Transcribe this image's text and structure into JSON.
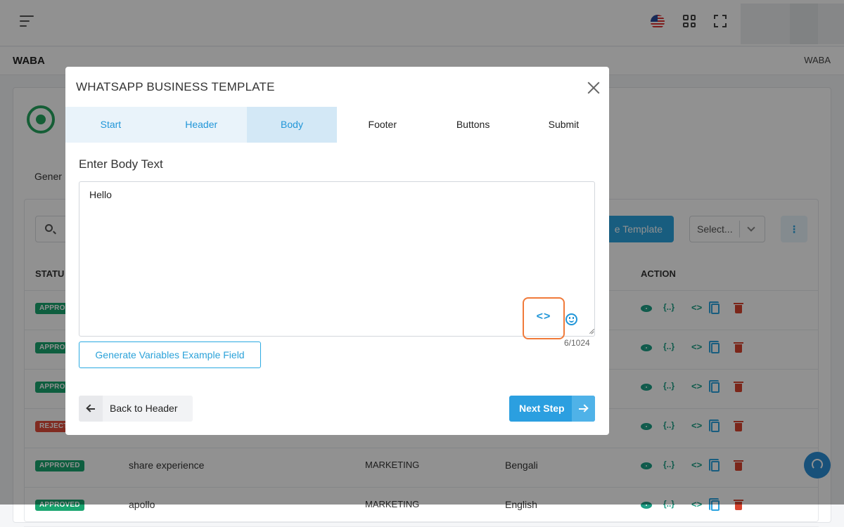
{
  "app": {
    "page_title": "WABA",
    "breadcrumb": "WABA",
    "tab_general": "Gener",
    "create_button": "e Template",
    "select_placeholder": "Select...",
    "table_headers": {
      "status": "STATU",
      "action": "ACTION"
    },
    "rows": [
      {
        "status": "APPRO",
        "status_type": "approved",
        "name": "",
        "category": "",
        "language": ""
      },
      {
        "status": "APPRO",
        "status_type": "approved",
        "name": "",
        "category": "",
        "language": ""
      },
      {
        "status": "APPRO",
        "status_type": "approved",
        "name": "",
        "category": "",
        "language": ""
      },
      {
        "status": "REJECT",
        "status_type": "rejected",
        "name": "",
        "category": "",
        "language": ""
      },
      {
        "status": "APPROVED",
        "status_type": "approved",
        "name": "share experience",
        "category": "MARKETING",
        "language": "Bengali"
      },
      {
        "status": "APPROVED",
        "status_type": "approved",
        "name": "apollo",
        "category": "MARKETING",
        "language": "English"
      }
    ],
    "action_icons": [
      "eye-icon",
      "variables-icon",
      "code-icon",
      "copy-icon",
      "trash-icon"
    ],
    "action_brace_text": "{..}",
    "action_code_text": "<>"
  },
  "modal": {
    "title": "WHATSAPP BUSINESS TEMPLATE",
    "steps": [
      {
        "label": "Start",
        "state": "done"
      },
      {
        "label": "Header",
        "state": "done"
      },
      {
        "label": "Body",
        "state": "active"
      },
      {
        "label": "Footer",
        "state": "todo"
      },
      {
        "label": "Buttons",
        "state": "todo"
      },
      {
        "label": "Submit",
        "state": "todo"
      }
    ],
    "section_title": "Enter Body Text",
    "body_text": "Hello",
    "code_button_glyph": "<>",
    "char_counter": "6/1024",
    "generate_button": "Generate Variables Example Field",
    "back_button": "Back to Header",
    "next_button": "Next Step"
  },
  "colors": {
    "primary": "#2b9fe0",
    "approved": "#19a56f",
    "rejected": "#e14d3a",
    "highlight": "#f07a3a"
  }
}
